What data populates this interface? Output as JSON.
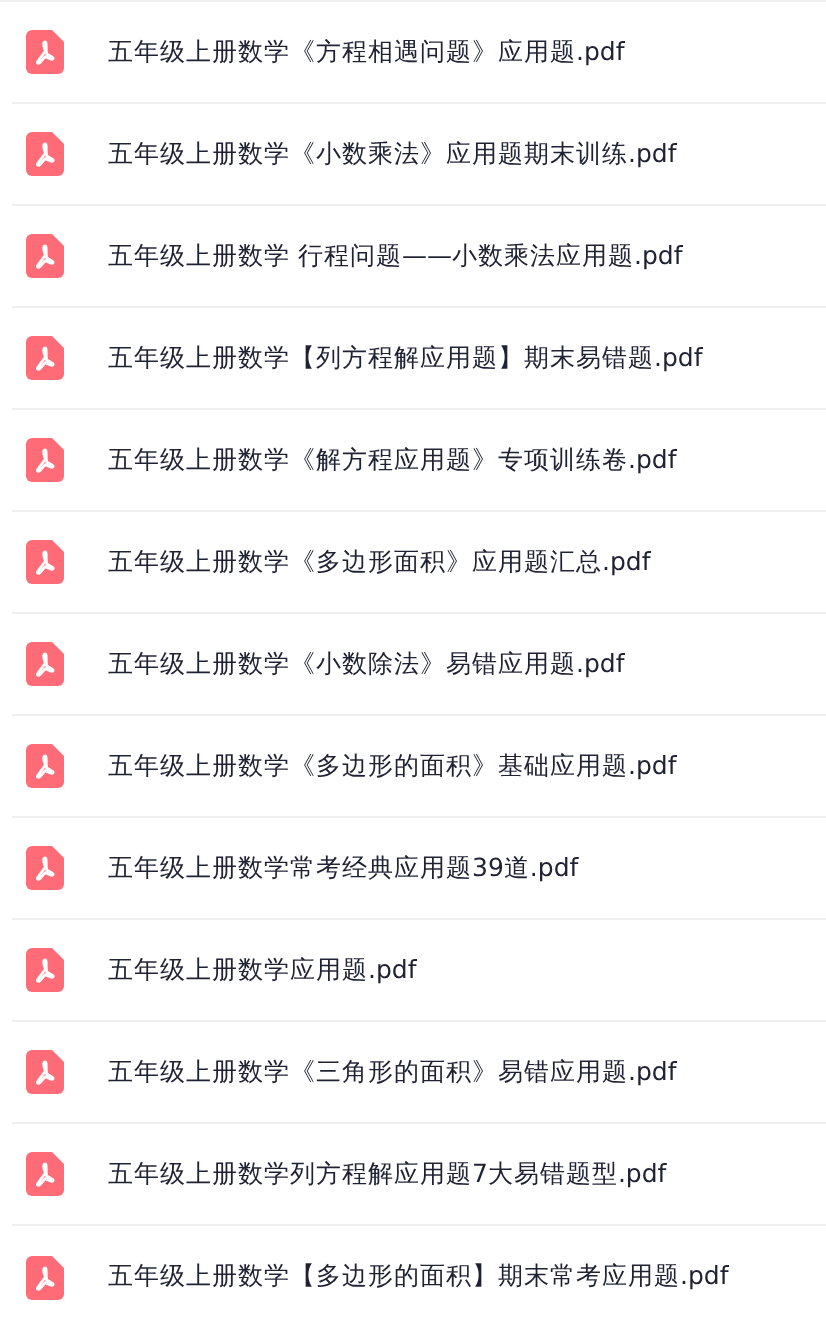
{
  "files": [
    {
      "name": "五年级上册数学《方程相遇问题》应用题.pdf"
    },
    {
      "name": "五年级上册数学《小数乘法》应用题期末训练.pdf"
    },
    {
      "name": "五年级上册数学 行程问题——小数乘法应用题.pdf"
    },
    {
      "name": "五年级上册数学【列方程解应用题】期末易错题.pdf"
    },
    {
      "name": "五年级上册数学《解方程应用题》专项训练卷.pdf"
    },
    {
      "name": "五年级上册数学《多边形面积》应用题汇总.pdf"
    },
    {
      "name": "五年级上册数学《小数除法》易错应用题.pdf"
    },
    {
      "name": "五年级上册数学《多边形的面积》基础应用题.pdf"
    },
    {
      "name": "五年级上册数学常考经典应用题39道.pdf"
    },
    {
      "name": "五年级上册数学应用题.pdf"
    },
    {
      "name": "五年级上册数学《三角形的面积》易错应用题.pdf"
    },
    {
      "name": "五年级上册数学列方程解应用题7大易错题型.pdf"
    },
    {
      "name": "五年级上册数学【多边形的面积】期末常考应用题.pdf"
    }
  ]
}
